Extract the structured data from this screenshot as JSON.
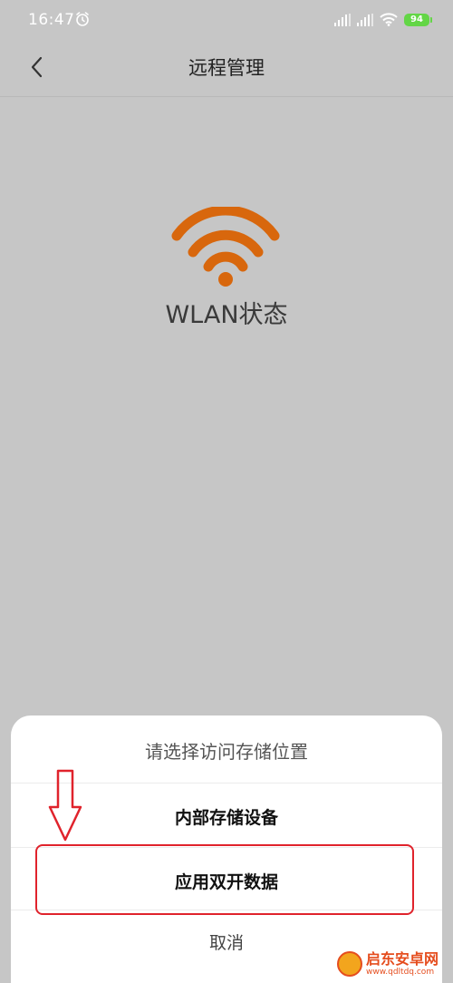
{
  "status_bar": {
    "time": "16:47",
    "alarm_icon": "alarm-clock-icon",
    "battery_level": "94",
    "battery_color": "#63d646"
  },
  "nav": {
    "back_icon": "chevron-left-icon",
    "title": "远程管理"
  },
  "main": {
    "wifi_icon": "wifi-icon",
    "wifi_color": "#d8670d",
    "status_label": "WLAN状态"
  },
  "sheet": {
    "title": "请选择访问存储位置",
    "options": [
      {
        "label": "内部存储设备"
      },
      {
        "label": "应用双开数据"
      }
    ],
    "cancel_label": "取消"
  },
  "annotation": {
    "color": "#e0232c",
    "arrow_icon": "down-arrow-icon"
  },
  "watermark": {
    "main_text": "启东安卓网",
    "url": "www.qdltdq.com"
  }
}
